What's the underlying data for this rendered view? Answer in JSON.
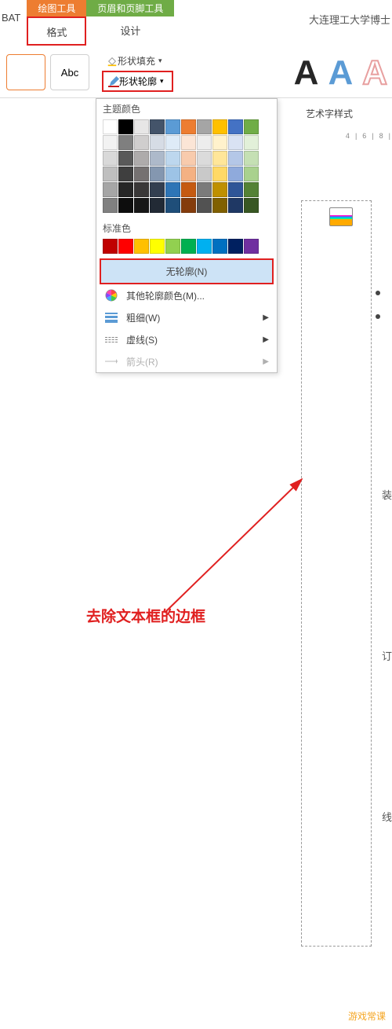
{
  "tabs": {
    "bat": "BAT",
    "drawing_tools_header": "绘图工具",
    "format": "格式",
    "header_footer_tools_header": "页眉和页脚工具",
    "design": "设计"
  },
  "doc_title": "大连理工大学博士",
  "shape_tile_abc": "Abc",
  "shape_fill": "形状填充",
  "shape_outline": "形状轮廓",
  "wordart_label": "艺术字样式",
  "ruler_marks": [
    "4",
    "6",
    "8"
  ],
  "panel": {
    "theme_colors": "主题颜色",
    "standard_colors": "标准色",
    "no_outline": "无轮廓(N)",
    "more_colors": "其他轮廓颜色(M)...",
    "weight": "粗细(W)",
    "dashes": "虚线(S)",
    "arrows": "箭头(R)"
  },
  "theme_color_grid": [
    [
      "#ffffff",
      "#000000",
      "#e7e6e6",
      "#44546a",
      "#5b9bd5",
      "#ed7d31",
      "#a5a5a5",
      "#ffc000",
      "#4472c4",
      "#70ad47"
    ],
    [
      "#f2f2f2",
      "#7f7f7f",
      "#d0cece",
      "#d6dce5",
      "#deebf7",
      "#fbe5d6",
      "#ededed",
      "#fff2cc",
      "#d9e2f3",
      "#e2f0d9"
    ],
    [
      "#d9d9d9",
      "#595959",
      "#aeabab",
      "#adb9ca",
      "#bdd7ee",
      "#f8cbad",
      "#dbdbdb",
      "#ffe699",
      "#b4c7e7",
      "#c5e0b4"
    ],
    [
      "#bfbfbf",
      "#3f3f3f",
      "#757171",
      "#8497b0",
      "#9dc3e6",
      "#f4b183",
      "#c9c9c9",
      "#ffd966",
      "#8faadc",
      "#a9d18e"
    ],
    [
      "#a6a6a6",
      "#262626",
      "#3a3838",
      "#333f50",
      "#2e75b6",
      "#c55a11",
      "#7b7b7b",
      "#bf9000",
      "#2f5597",
      "#548235"
    ],
    [
      "#808080",
      "#0d0d0d",
      "#171717",
      "#222a35",
      "#1f4e79",
      "#843c0c",
      "#525252",
      "#806000",
      "#1f3864",
      "#385723"
    ]
  ],
  "standard_colors": [
    "#c00000",
    "#ff0000",
    "#ffc000",
    "#ffff00",
    "#92d050",
    "#00b050",
    "#00b0f0",
    "#0070c0",
    "#002060",
    "#7030a0"
  ],
  "textbox_vert": {
    "c1": "装",
    "c2": "订",
    "c3": "线"
  },
  "annotation": "去除文本框的边框",
  "watermark": "游戏常课"
}
